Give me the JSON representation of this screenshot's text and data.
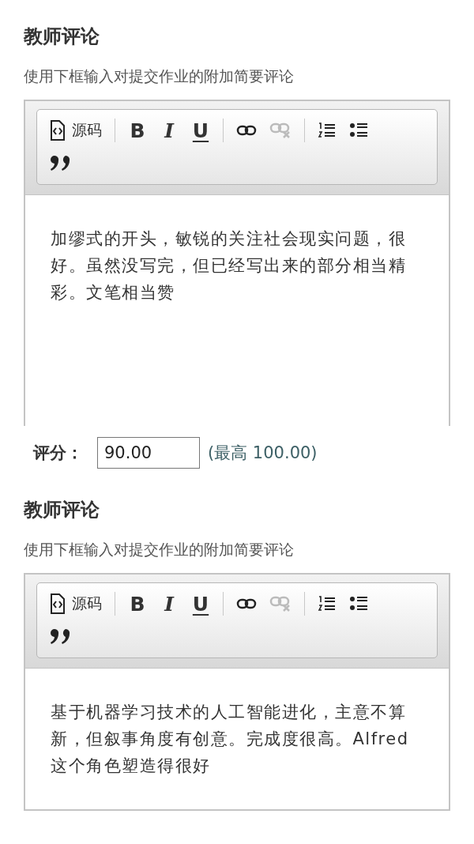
{
  "sections": [
    {
      "title": "教师评论",
      "description": "使用下框输入对提交作业的附加简要评论",
      "editor": {
        "toolbar_rows": [
          [
            [
              {
                "kind": "source",
                "label": "源码",
                "disabled": false
              }
            ],
            [
              {
                "kind": "bold",
                "label": "B",
                "disabled": false
              },
              {
                "kind": "italic",
                "label": "I",
                "disabled": false
              },
              {
                "kind": "underline",
                "label": "U",
                "disabled": false
              }
            ],
            [
              {
                "kind": "link",
                "disabled": false
              },
              {
                "kind": "unlink",
                "disabled": true
              }
            ],
            [
              {
                "kind": "ordered-list",
                "disabled": false
              },
              {
                "kind": "bullet-list",
                "disabled": false
              }
            ]
          ],
          [
            [
              {
                "kind": "blockquote",
                "disabled": false
              }
            ]
          ]
        ],
        "content": "加缪式的开头，敏锐的关注社会现实问题，很好。虽然没写完，但已经写出来的部分相当精彩。文笔相当赞"
      },
      "score": {
        "label": "评分：",
        "value": "90.00",
        "note": "(最高 100.00)"
      }
    },
    {
      "title": "教师评论",
      "description": "使用下框输入对提交作业的附加简要评论",
      "editor": {
        "toolbar_rows": [
          [
            [
              {
                "kind": "source",
                "label": "源码",
                "disabled": false
              }
            ],
            [
              {
                "kind": "bold",
                "label": "B",
                "disabled": false
              },
              {
                "kind": "italic",
                "label": "I",
                "disabled": false
              },
              {
                "kind": "underline",
                "label": "U",
                "disabled": false
              }
            ],
            [
              {
                "kind": "link",
                "disabled": false
              },
              {
                "kind": "unlink",
                "disabled": true
              }
            ],
            [
              {
                "kind": "ordered-list",
                "disabled": false
              },
              {
                "kind": "bullet-list",
                "disabled": false
              }
            ]
          ],
          [
            [
              {
                "kind": "blockquote",
                "disabled": false
              }
            ]
          ]
        ],
        "content": "基于机器学习技术的人工智能进化，主意不算新，但叙事角度有创意。完成度很高。Alfred这个角色塑造得很好"
      }
    }
  ]
}
